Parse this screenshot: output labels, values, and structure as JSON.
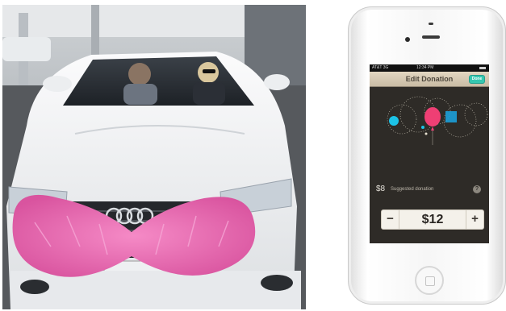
{
  "photo": {
    "subject": "white car with pink mustache on grille"
  },
  "phone": {
    "status": {
      "carrier": "AT&T 3G",
      "time": "12:34 PM"
    },
    "nav": {
      "title": "Edit Donation",
      "done_label": "Done"
    },
    "suggested": {
      "amount": "$8",
      "label": "Suggested donation",
      "help": "?"
    },
    "stepper": {
      "minus": "−",
      "value": "$12",
      "plus": "+"
    }
  },
  "colors": {
    "mustache_pink": "#ec6fb6",
    "done_teal": "#35c7b0",
    "screen_dark": "#2e2b27",
    "car_white": "#f2f3f4"
  },
  "icons": [
    "help-icon",
    "home-button-icon",
    "front-camera-icon",
    "battery-icon",
    "balloon-icon"
  ]
}
